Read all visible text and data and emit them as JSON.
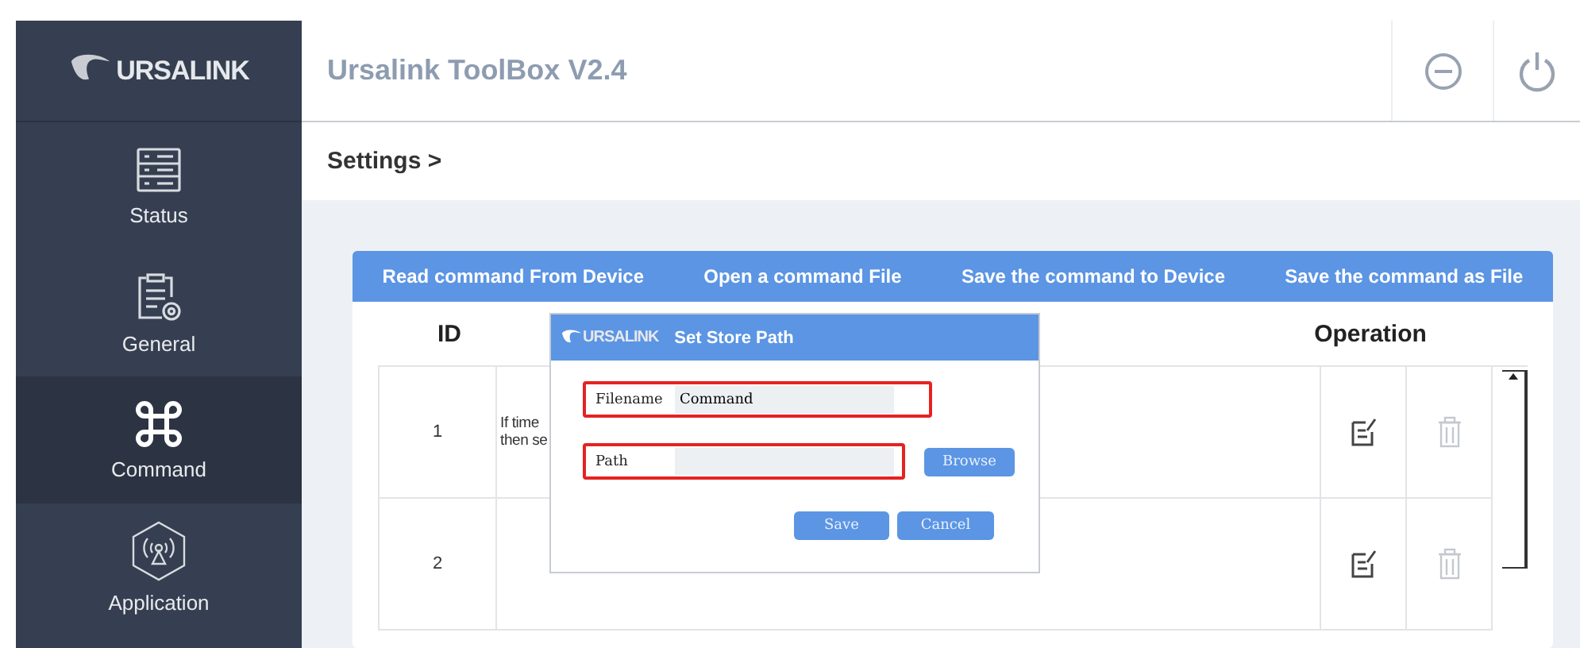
{
  "sidebar": {
    "logo": "URSALINK",
    "items": [
      {
        "kind": "status",
        "label": "Status",
        "selected": false
      },
      {
        "kind": "general",
        "label": "General",
        "selected": false
      },
      {
        "kind": "command",
        "label": "Command",
        "selected": true
      },
      {
        "kind": "application",
        "label": "Application",
        "selected": false
      }
    ]
  },
  "header": {
    "title": "Ursalink ToolBox V2.4"
  },
  "breadcrumb": "Settings >",
  "toolbar": [
    "Read command From Device",
    "Open a command File",
    "Save the command to Device",
    "Save the command as File"
  ],
  "table": {
    "columns": [
      "ID",
      "Operation"
    ],
    "rows": [
      {
        "id": "1",
        "text": [
          "If time",
          "then se"
        ]
      },
      {
        "id": "2",
        "text": []
      }
    ]
  },
  "dialog": {
    "logo": "URSALINK",
    "title": "Set Store Path",
    "fields": [
      {
        "label": "Filename",
        "value": "Command",
        "highlighted": true
      },
      {
        "label": "Path",
        "highlighted": true
      }
    ],
    "browse": "Browse",
    "buttons": [
      "Save",
      "Cancel"
    ]
  }
}
